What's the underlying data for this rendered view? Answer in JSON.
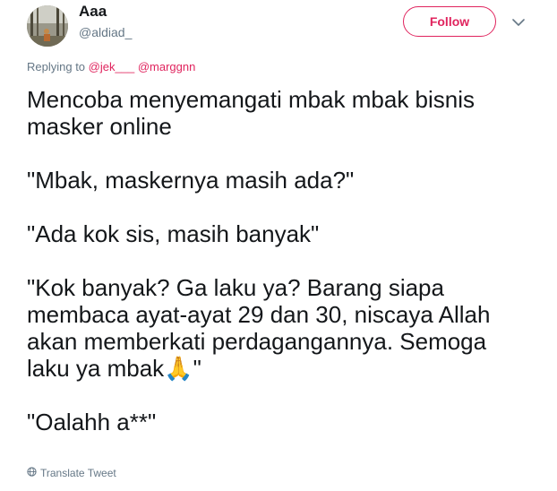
{
  "author": {
    "display_name": "Aaa",
    "username": "@aldiad_"
  },
  "follow_label": "Follow",
  "reply": {
    "prefix": "Replying to",
    "mentions": [
      "@jek___",
      "@marggnn"
    ]
  },
  "tweet": {
    "line1": "Mencoba menyemangati mbak mbak bisnis",
    "line2": "masker online",
    "line3": "\"Mbak, maskernya masih ada?\"",
    "line4": "\"Ada kok sis, masih banyak\"",
    "line5": "\"Kok banyak? Ga laku ya? Barang siapa",
    "line6": "membaca ayat-ayat 29 dan 30, niscaya Allah",
    "line7": "akan memberkati perdagangannya. Semoga",
    "line8_text": "laku ya mbak",
    "line8_emoji": "🙏",
    "line8_end": "\"",
    "line9": "\"Oalahh a**\""
  },
  "translate_label": "Translate Tweet",
  "icons": {
    "chevron": "chevron-down-icon",
    "globe": "globe-icon",
    "emoji": "folded-hands-emoji"
  },
  "colors": {
    "accent": "#e0245e",
    "secondary_text": "#657786",
    "primary_text": "#14171a"
  }
}
